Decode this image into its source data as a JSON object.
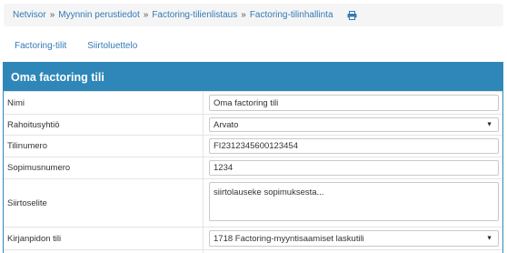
{
  "breadcrumb": {
    "items": [
      "Netvisor",
      "Myynnin perustiedot",
      "Factoring-tilienlistaus",
      "Factoring-tilinhallinta"
    ],
    "separator": "»",
    "print_icon": "printer-icon"
  },
  "tabs": [
    "Factoring-tilit",
    "Siirtoluettelo"
  ],
  "panel": {
    "title": "Oma factoring tili",
    "header_color": "#2e87b8"
  },
  "form": {
    "name": {
      "label": "Nimi",
      "value": "Oma factoring tili"
    },
    "financier": {
      "label": "Rahoitusyhtiö",
      "value": "Arvato"
    },
    "account_number": {
      "label": "Tilinumero",
      "value": "FI2312345600123454"
    },
    "contract_number": {
      "label": "Sopimusnumero",
      "value": "1234"
    },
    "transfer_text": {
      "label": "Siirtoselite",
      "value": "siirtolauseke sopimuksesta..."
    },
    "ledger_account": {
      "label": "Kirjanpidon tili",
      "value": "1718 Factoring-myyntisaamiset laskutili"
    }
  }
}
